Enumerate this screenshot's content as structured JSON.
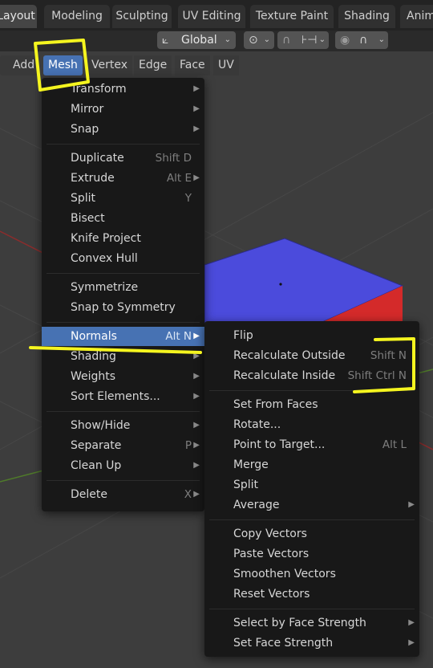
{
  "workspace_tabs": [
    "Layout",
    "Modeling",
    "Sculpting",
    "UV Editing",
    "Texture Paint",
    "Shading",
    "Anim"
  ],
  "header": {
    "orientation": "Global"
  },
  "menubar": [
    "Add",
    "Mesh",
    "Vertex",
    "Edge",
    "Face",
    "UV"
  ],
  "mesh_menu": {
    "items": [
      {
        "label": "Transform",
        "shortcut": "",
        "submenu": true
      },
      {
        "label": "Mirror",
        "shortcut": "",
        "submenu": true
      },
      {
        "label": "Snap",
        "shortcut": "",
        "submenu": true
      },
      {
        "label": "Duplicate",
        "shortcut": "Shift D",
        "submenu": false
      },
      {
        "label": "Extrude",
        "shortcut": "Alt E",
        "submenu": true
      },
      {
        "label": "Split",
        "shortcut": "Y",
        "submenu": false
      },
      {
        "label": "Bisect",
        "shortcut": "",
        "submenu": false
      },
      {
        "label": "Knife Project",
        "shortcut": "",
        "submenu": false
      },
      {
        "label": "Convex Hull",
        "shortcut": "",
        "submenu": false
      },
      {
        "label": "Symmetrize",
        "shortcut": "",
        "submenu": false
      },
      {
        "label": "Snap to Symmetry",
        "shortcut": "",
        "submenu": false
      },
      {
        "label": "Normals",
        "shortcut": "Alt N",
        "submenu": true
      },
      {
        "label": "Shading",
        "shortcut": "",
        "submenu": true
      },
      {
        "label": "Weights",
        "shortcut": "",
        "submenu": true
      },
      {
        "label": "Sort Elements...",
        "shortcut": "",
        "submenu": true
      },
      {
        "label": "Show/Hide",
        "shortcut": "",
        "submenu": true
      },
      {
        "label": "Separate",
        "shortcut": "P",
        "submenu": true
      },
      {
        "label": "Clean Up",
        "shortcut": "",
        "submenu": true
      },
      {
        "label": "Delete",
        "shortcut": "X",
        "submenu": true
      }
    ]
  },
  "normals_menu": {
    "items": [
      {
        "label": "Flip",
        "shortcut": "",
        "submenu": false
      },
      {
        "label": "Recalculate Outside",
        "shortcut": "Shift N",
        "submenu": false
      },
      {
        "label": "Recalculate Inside",
        "shortcut": "Shift Ctrl N",
        "submenu": false
      },
      {
        "label": "Set From Faces",
        "shortcut": "",
        "submenu": false
      },
      {
        "label": "Rotate...",
        "shortcut": "",
        "submenu": false
      },
      {
        "label": "Point to Target...",
        "shortcut": "Alt L",
        "submenu": false
      },
      {
        "label": "Merge",
        "shortcut": "",
        "submenu": false
      },
      {
        "label": "Split",
        "shortcut": "",
        "submenu": false
      },
      {
        "label": "Average",
        "shortcut": "",
        "submenu": true
      },
      {
        "label": "Copy Vectors",
        "shortcut": "",
        "submenu": false
      },
      {
        "label": "Paste Vectors",
        "shortcut": "",
        "submenu": false
      },
      {
        "label": "Smoothen Vectors",
        "shortcut": "",
        "submenu": false
      },
      {
        "label": "Reset Vectors",
        "shortcut": "",
        "submenu": false
      },
      {
        "label": "Select by Face Strength",
        "shortcut": "",
        "submenu": true
      },
      {
        "label": "Set Face Strength",
        "shortcut": "",
        "submenu": true
      }
    ]
  },
  "colors": {
    "accent": "#4772b3",
    "menu_bg": "#181818",
    "viewport": "#3d3d3d",
    "cube_top": "#4b4bdc",
    "cube_side": "#d42a2a",
    "annotation": "#f5f51f"
  }
}
